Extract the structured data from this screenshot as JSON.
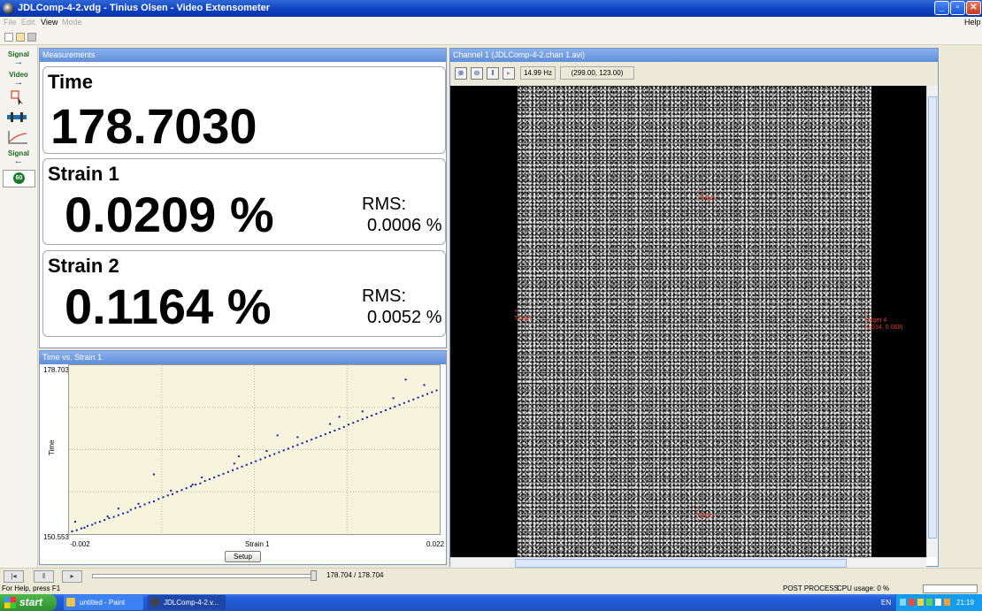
{
  "window": {
    "title": "JDLComp-4-2.vdg - Tinius Olsen - Video Extensometer"
  },
  "menu": {
    "items": [
      "File",
      "Edit",
      "View",
      "Mode"
    ],
    "help": "Help"
  },
  "tools": {
    "signal_in_label": "Signal",
    "video_label": "Video",
    "signal_out_label": "Signal",
    "badge_label": "60"
  },
  "measurements": {
    "panel_title": "Measurements",
    "time": {
      "label": "Time",
      "value": "178.7030"
    },
    "strain1": {
      "label": "Strain 1",
      "value": "0.0209 %",
      "rms_label": "RMS:",
      "rms_value": "0.0006 %"
    },
    "strain2": {
      "label": "Strain 2",
      "value": "0.1164 %",
      "rms_label": "RMS:",
      "rms_value": "0.0052 %"
    }
  },
  "chart_data": {
    "type": "scatter",
    "title": "Time vs. Strain 1",
    "xlabel": "Strain 1",
    "ylabel": "Time",
    "xlim": [
      -0.002,
      0.022
    ],
    "ylim": [
      150.553,
      178.703
    ],
    "x_tick_labels": [
      "-0.002",
      "0.022"
    ],
    "y_tick_labels": [
      "178.703",
      "150.553"
    ],
    "grid": true,
    "color": "#1a1aa8",
    "points_x": [
      -0.0018,
      -0.0015,
      -0.0012,
      -0.001,
      -0.0008,
      -0.0005,
      -0.0003,
      0.0,
      0.0003,
      0.0006,
      0.0009,
      0.0012,
      0.0015,
      0.0018,
      0.002,
      0.0023,
      0.0026,
      0.0029,
      0.0032,
      0.0035,
      0.0038,
      0.0041,
      0.0044,
      0.0047,
      0.005,
      0.0053,
      0.0056,
      0.0059,
      0.0062,
      0.0065,
      0.0068,
      0.0071,
      0.0074,
      0.0077,
      0.008,
      0.0083,
      0.0086,
      0.0089,
      0.0092,
      0.0095,
      0.0098,
      0.0101,
      0.0104,
      0.0107,
      0.011,
      0.0113,
      0.0116,
      0.0119,
      0.0122,
      0.0125,
      0.0128,
      0.0131,
      0.0134,
      0.0137,
      0.014,
      0.0143,
      0.0146,
      0.0149,
      0.0152,
      0.0155,
      0.0158,
      0.0161,
      0.0164,
      0.0167,
      0.017,
      0.0173,
      0.0176,
      0.0179,
      0.0182,
      0.0185,
      0.0188,
      0.0191,
      0.0194,
      0.0197,
      0.02,
      0.0203,
      0.0206,
      0.0209,
      0.0212,
      0.0215,
      0.0218,
      -0.0016,
      0.0005,
      0.0025,
      0.0046,
      0.0066,
      0.0087,
      0.0108,
      0.0128,
      0.0149,
      0.017,
      0.019,
      0.021,
      0.0035,
      0.006,
      0.0012,
      0.009,
      0.0155,
      0.0198,
      0.0115
    ],
    "points_y": [
      151.0,
      151.2,
      151.5,
      151.6,
      151.9,
      152.1,
      152.4,
      152.6,
      152.9,
      153.2,
      153.4,
      153.7,
      154.0,
      154.2,
      154.6,
      154.9,
      155.1,
      155.5,
      155.8,
      156.0,
      156.4,
      156.7,
      157.0,
      157.2,
      157.6,
      157.9,
      158.2,
      158.5,
      158.8,
      159.0,
      159.4,
      159.7,
      160.0,
      160.3,
      160.6,
      160.9,
      161.2,
      161.5,
      161.8,
      162.1,
      162.4,
      162.7,
      163.0,
      163.3,
      163.6,
      163.9,
      164.2,
      164.5,
      164.8,
      165.1,
      165.4,
      165.7,
      166.0,
      166.3,
      166.6,
      166.9,
      167.2,
      167.5,
      167.8,
      168.1,
      168.4,
      168.8,
      169.1,
      169.4,
      169.7,
      170.0,
      170.3,
      170.6,
      170.9,
      171.2,
      171.5,
      171.8,
      172.1,
      172.4,
      172.7,
      173.0,
      173.3,
      173.6,
      173.9,
      174.2,
      174.5,
      152.6,
      153.5,
      155.6,
      157.8,
      160.0,
      162.3,
      164.4,
      166.7,
      168.9,
      171.0,
      173.2,
      175.4,
      160.5,
      158.8,
      154.8,
      163.5,
      170.1,
      176.3,
      167.0
    ],
    "setup_label": "Setup"
  },
  "video": {
    "panel_title": "Channel 1 (JDLComp-4-2.chan 1.avi)",
    "frequency": "14.99 Hz",
    "coordinates": "(299.00,  123.00)",
    "targets": [
      {
        "name": "Target 4",
        "coords": "(0.034, 0.068)"
      }
    ]
  },
  "playback": {
    "time": "178.704 / 178.704",
    "progress": 1.0
  },
  "status": {
    "help_text": "For Help, press F1",
    "mode_text": "POST PROCESS",
    "cpu_text": "CPU usage:   0 %"
  },
  "taskbar": {
    "start_label": "start",
    "items": [
      "untitled - Paint",
      "JDLComp-4-2.v..."
    ],
    "lang": "EN",
    "clock": "21:19"
  }
}
